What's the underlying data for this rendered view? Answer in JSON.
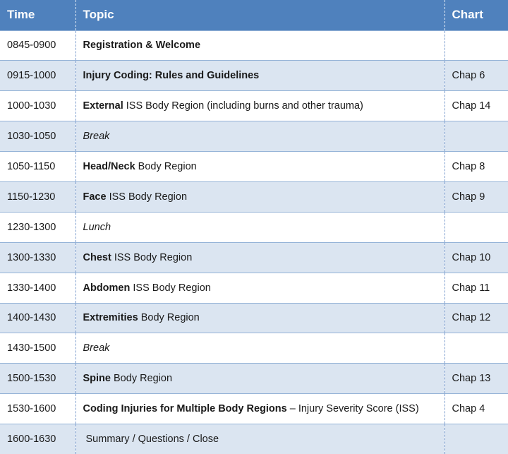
{
  "header": {
    "time": "Time",
    "topic": "Topic",
    "chart": "Chart"
  },
  "rows": [
    {
      "time": "0845-0900",
      "bold": "Registration & Welcome",
      "rest": "",
      "chart": ""
    },
    {
      "time": "0915-1000",
      "bold": "Injury Coding: Rules and Guidelines",
      "rest": "",
      "chart": "Chap 6"
    },
    {
      "time": "1000-1030",
      "bold": "External",
      "rest": " ISS Body Region (including burns and other trauma)",
      "chart": "Chap 14"
    },
    {
      "time": "1030-1050",
      "italic": "Break",
      "chart": ""
    },
    {
      "time": "1050-1150",
      "bold": "Head/Neck",
      "rest": " Body Region",
      "chart": "Chap 8"
    },
    {
      "time": "1150-1230",
      "bold": "Face",
      "rest": " ISS Body Region",
      "chart": "Chap 9"
    },
    {
      "time": "1230-1300",
      "italic": "Lunch",
      "chart": ""
    },
    {
      "time": "1300-1330",
      "bold": "Chest",
      "rest": " ISS Body Region",
      "chart": "Chap 10"
    },
    {
      "time": "1330-1400",
      "bold": "Abdomen",
      "rest": " ISS Body Region",
      "chart": "Chap 11"
    },
    {
      "time": "1400-1430",
      "bold": "Extremities",
      "rest": " Body Region",
      "chart": "Chap 12"
    },
    {
      "time": "1430-1500",
      "italic": "Break",
      "chart": ""
    },
    {
      "time": "1500-1530",
      "bold": "Spine",
      "rest": " Body Region",
      "chart": "Chap 13"
    },
    {
      "time": "1530-1600",
      "bold": "Coding Injuries for Multiple Body Regions",
      "rest": " – Injury Severity Score (ISS)",
      "chart": "Chap 4"
    },
    {
      "time": "1600-1630",
      "plain": "Summary  / Questions / Close",
      "chart": ""
    }
  ]
}
